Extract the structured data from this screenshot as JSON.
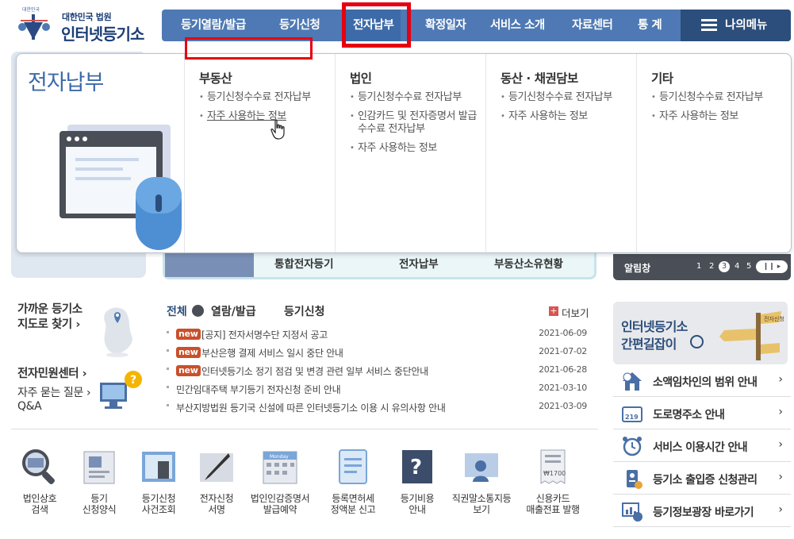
{
  "logo": {
    "org": "대한민국 법원",
    "name": "인터넷등기소",
    "emblem_text": "대한민국"
  },
  "gnb": {
    "items": [
      "등기열람/발급",
      "등기신청",
      "전자납부",
      "확정일자",
      "서비스 소개",
      "자료센터",
      "통 계"
    ],
    "active": "전자납부",
    "my_menu": "나의메뉴"
  },
  "dropdown": {
    "title": "전자납부",
    "columns": [
      {
        "title": "부동산",
        "items": [
          "등기신청수수료 전자납부",
          "자주 사용하는 정보"
        ]
      },
      {
        "title": "법인",
        "items": [
          "등기신청수수료 전자납부",
          "인감카드 및 전자증명서 발급수수료 전자납부",
          "자주 사용하는 정보"
        ]
      },
      {
        "title": "동산 · 채권담보",
        "items": [
          "등기신청수수료 전자납부",
          "자주 사용하는 정보"
        ]
      },
      {
        "title": "기타",
        "items": [
          "등기신청수수료 전자납부",
          "자주 사용하는 정보"
        ]
      }
    ]
  },
  "background": {
    "shortcuts": [
      "통합전자등기",
      "전자납부",
      "부동산소유현황"
    ],
    "alarm_title": "알림창",
    "alarm_pages": [
      "1",
      "2",
      "3",
      "4",
      "5"
    ],
    "alarm_current": "3"
  },
  "quick_links": {
    "nearby": "가까운 등기소",
    "map": "지도로 찾기",
    "civil": "전자민원센터",
    "faq": "자주 묻는 질문",
    "qa": "Q&A"
  },
  "notices": {
    "tabs": [
      "전체",
      "열람/발급",
      "등기신청"
    ],
    "more": "더보기",
    "new_badge": "new",
    "items": [
      {
        "new": true,
        "title": "[공지] 전자서명수단 지정서 공고",
        "date": "2021-06-09"
      },
      {
        "new": true,
        "title": "부산은행 결제 서비스 일시 중단 안내",
        "date": "2021-07-02"
      },
      {
        "new": true,
        "title": "인터넷등기소 정기 점검 및 변경 관련 일부 서비스 중단안내",
        "date": "2021-06-28"
      },
      {
        "new": false,
        "title": "민간임대주택 부기등기 전자신청 준비 안내",
        "date": "2021-03-10"
      },
      {
        "new": false,
        "title": "부산지방법원 등기국 신설에 따른 인터넷등기소 이용 시 유의사항 안내",
        "date": "2021-03-09"
      }
    ]
  },
  "services": [
    {
      "l1": "법인상호",
      "l2": "검색"
    },
    {
      "l1": "등기",
      "l2": "신청양식"
    },
    {
      "l1": "등기신청",
      "l2": "사건조회"
    },
    {
      "l1": "전자신청",
      "l2": "서명"
    },
    {
      "l1": "법인인감증명서",
      "l2": "발급예약"
    },
    {
      "l1": "등록면허세",
      "l2": "정액분 신고"
    },
    {
      "l1": "등기비용",
      "l2": "안내"
    },
    {
      "l1": "직권말소통지등",
      "l2": "보기"
    },
    {
      "l1": "신용카드",
      "l2": "매출전표 발행"
    }
  ],
  "banner": {
    "line1": "인터넷등기소",
    "line2": "간편길잡이",
    "sign_text": "전자신청"
  },
  "right_links": [
    "소액임차인의 범위 안내",
    "도로명주소 안내",
    "서비스 이용시간 안내",
    "등기소 출입증 신청관리",
    "등기정보광장 바로가기"
  ],
  "icon_texts": {
    "road_sign": "219",
    "receipt": "₩1700",
    "calendar": "Monday"
  },
  "colors": {
    "nav": "#4e79b4",
    "nav_dark": "#2c4e7c",
    "highlight": "#e60012",
    "new_badge": "#c9502a"
  }
}
